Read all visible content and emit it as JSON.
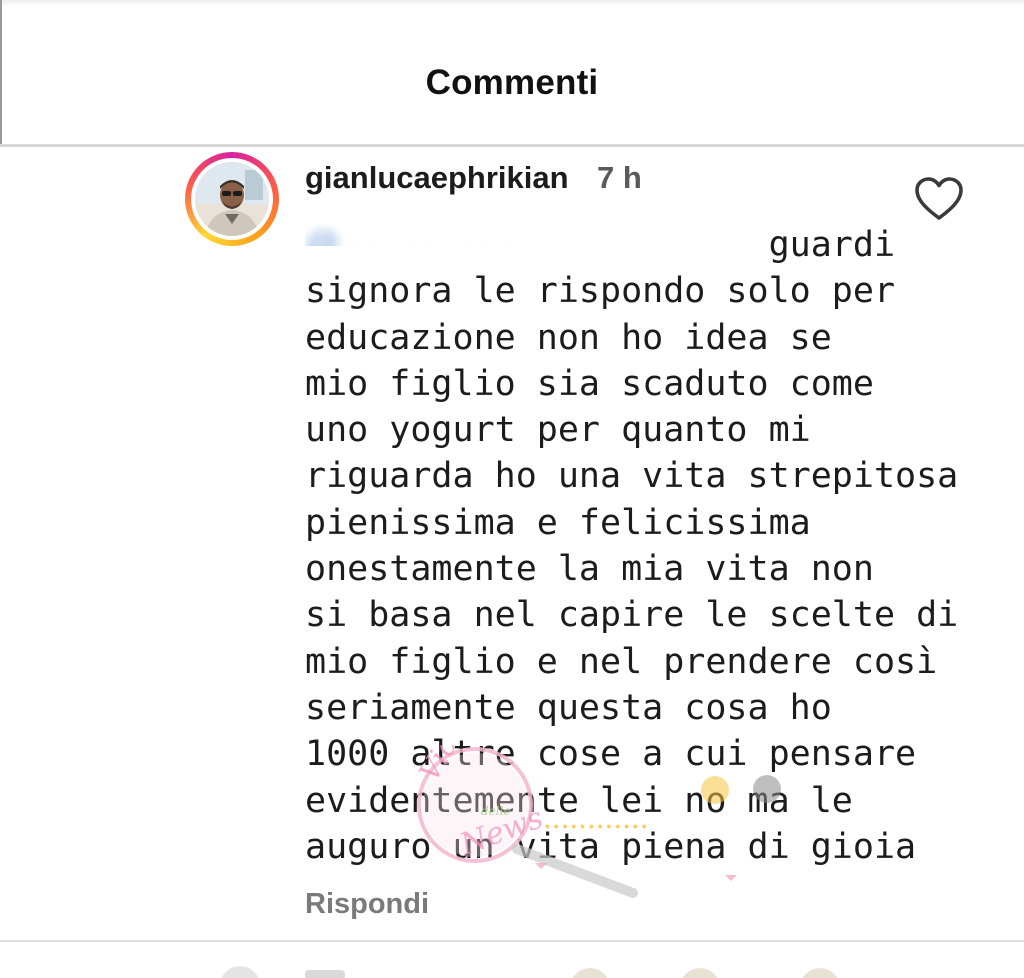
{
  "header": {
    "title": "Commenti"
  },
  "comment": {
    "username": "gianlucaephrikian",
    "time": "7 h",
    "body_lines": [
      "                      guardi",
      "signora le rispondo solo per",
      "educazione non ho idea se",
      "mio figlio sia scaduto come",
      "uno yogurt per quanto mi",
      "riguarda ho una vita strepitosa",
      "pienissima e felicissima",
      "onestamente la mia vita non",
      "si basa nel capire le scelte di",
      "mio figlio e nel prendere così",
      "seriamente questa cosa ho",
      "1000 altre cose a cui pensare",
      "evidentemente lei no ma le",
      "auguro un vita piena di gioia"
    ],
    "reply_label": "Rispondi"
  },
  "watermark": {
    "line1": "Vicolo",
    "line2": "delle",
    "line3": "News"
  },
  "colors": {
    "text": "#1c1c1c",
    "muted": "#7a7a7a",
    "divider": "#d6d6d6",
    "mention": "#2b6fbf"
  },
  "icons": {
    "like": "heart-outline-icon",
    "avatar_ring": "story-ring"
  }
}
